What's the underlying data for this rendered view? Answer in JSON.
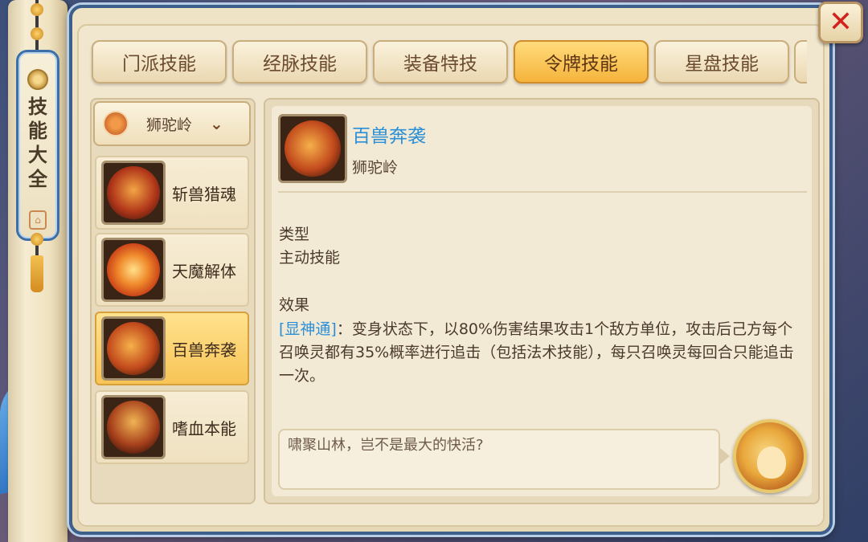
{
  "window": {
    "title": "技能大全",
    "close_label": "✕"
  },
  "tabs": [
    {
      "label": "门派技能",
      "active": false
    },
    {
      "label": "经脉技能",
      "active": false
    },
    {
      "label": "装备特技",
      "active": false
    },
    {
      "label": "令牌技能",
      "active": true
    },
    {
      "label": "星盘技能",
      "active": false
    }
  ],
  "school_select": {
    "label": "狮驼岭",
    "icon": "lion-emblem-icon",
    "chevron": "⌄"
  },
  "skills": [
    {
      "name": "斩兽猎魂",
      "icon": "beast-slash-icon",
      "selected": false,
      "color": "#b2381a"
    },
    {
      "name": "天魔解体",
      "icon": "demon-release-icon",
      "selected": false,
      "color": "#d9531c"
    },
    {
      "name": "百兽奔袭",
      "icon": "beast-stampede-icon",
      "selected": true,
      "color": "#b2381a"
    },
    {
      "name": "嗜血本能",
      "icon": "bloodlust-icon",
      "selected": false,
      "color": "#a8421c"
    }
  ],
  "detail": {
    "title": "百兽奔袭",
    "subtitle": "狮驼岭",
    "type_label": "类型",
    "type_value": "主动技能",
    "effect_label": "效果",
    "effect_keyword": "[显神通]",
    "effect_text": "：变身状态下，以80%伤害结果攻击1个敌方单位，攻击后己方每个召唤灵都有35%概率进行追击（包括法术技能），每只召唤灵每回合只能追击一次。",
    "quote": "啸聚山林，岂不是最大的快活?"
  },
  "colors": {
    "accent_blue": "#2b8fd8",
    "active_tab": "#f5b43c",
    "close_red": "#d3211d"
  }
}
